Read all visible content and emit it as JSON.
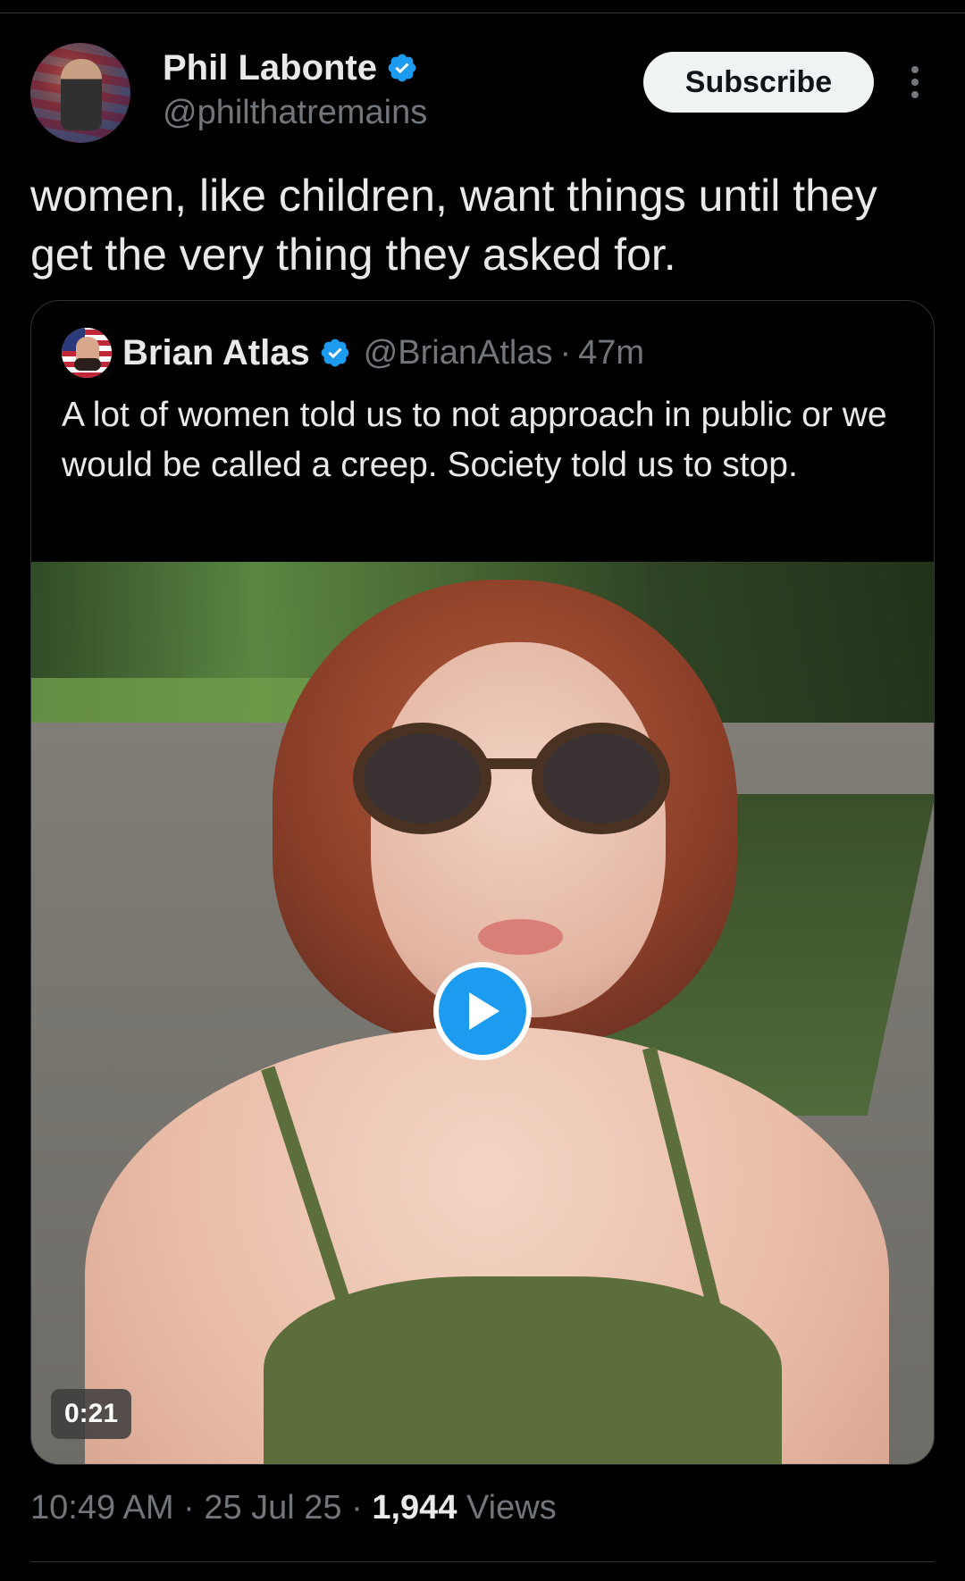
{
  "post": {
    "author": {
      "display_name": "Phil Labonte",
      "handle": "@philthatremains",
      "verified_icon": "verified-badge-icon"
    },
    "subscribe_label": "Subscribe",
    "text": "women, like children, want things until they get the very thing they asked for.",
    "timestamp": "10:49 AM",
    "separator": "·",
    "date": "25 Jul 25",
    "views_count": "1,944",
    "views_label": "Views"
  },
  "quote": {
    "display_name": "Brian Atlas",
    "handle": "@BrianAtlas",
    "separator": "·",
    "time_ago": "47m",
    "text": "A lot of women told us to not approach in public or we would be called a creep. Society told us to stop.",
    "video": {
      "duration": "0:21",
      "play_icon": "play-icon"
    }
  },
  "colors": {
    "background": "#000000",
    "text_primary": "#e7e9ea",
    "text_secondary": "#71767b",
    "accent": "#1d9bf0",
    "border": "#2f3336"
  }
}
